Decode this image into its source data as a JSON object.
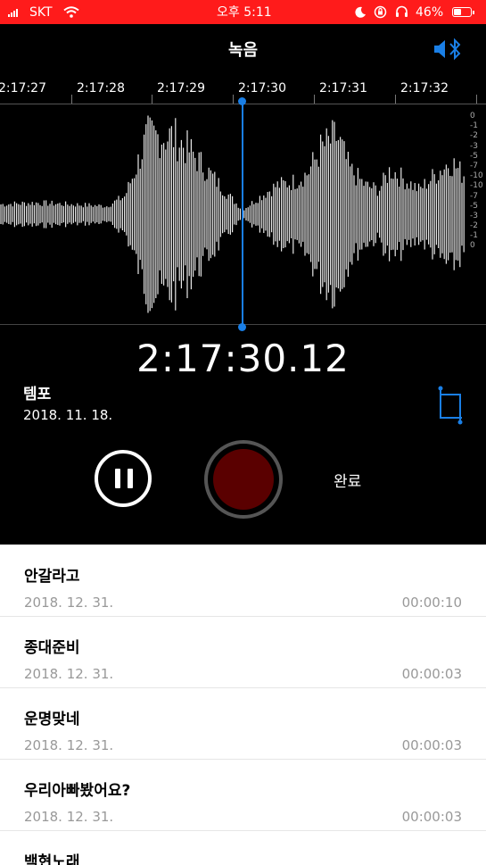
{
  "status_bar": {
    "carrier": "SKT",
    "time": "오후 5:11",
    "battery": "46%",
    "battery_level": 0.46,
    "background": "#ff1b1b"
  },
  "recorder": {
    "title": "녹음",
    "timeline_labels": [
      "2:17:27",
      "2:17:28",
      "2:17:29",
      "2:17:30",
      "2:17:31",
      "2:17:32"
    ],
    "db_scale": [
      "0",
      "-1",
      "-2",
      "-3",
      "-5",
      "-7",
      "-10",
      "-10",
      "-7",
      "-5",
      "-3",
      "-2",
      "-1",
      "0"
    ],
    "current_time": "2:17:30.12",
    "recording_name": "템포",
    "recording_date": "2018. 11. 18.",
    "done_label": "완료",
    "accent_color": "#1a7fe6",
    "icons": {
      "speaker": "speaker-bluetooth-icon",
      "trim": "trim-icon",
      "pause": "pause-icon",
      "record": "record-icon"
    }
  },
  "recordings": [
    {
      "name": "안갈라고",
      "date": "2018. 12. 31.",
      "duration": "00:00:10"
    },
    {
      "name": "종대준비",
      "date": "2018. 12. 31.",
      "duration": "00:00:03"
    },
    {
      "name": "운명맞네",
      "date": "2018. 12. 31.",
      "duration": "00:00:03"
    },
    {
      "name": "우리아빠봤어요?",
      "date": "2018. 12. 31.",
      "duration": "00:00:03"
    },
    {
      "name": "백현노래",
      "date": "",
      "duration": ""
    }
  ]
}
